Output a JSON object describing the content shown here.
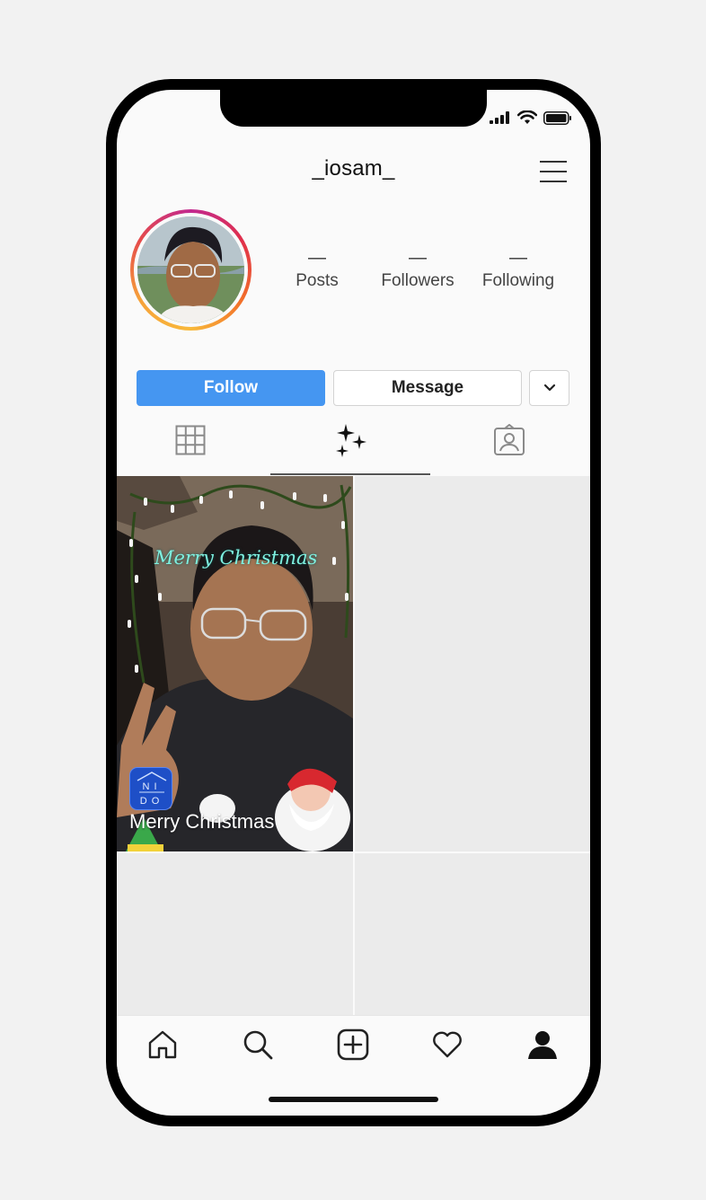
{
  "profile": {
    "username": "_iosam_",
    "stats": [
      {
        "value": "—",
        "label": "Posts"
      },
      {
        "value": "—",
        "label": "Followers"
      },
      {
        "value": "—",
        "label": "Following"
      }
    ]
  },
  "actions": {
    "follow_label": "Follow",
    "message_label": "Message"
  },
  "tabs": [
    {
      "icon": "grid-icon"
    },
    {
      "icon": "sparkles-icon",
      "active": true
    },
    {
      "icon": "tagged-icon"
    }
  ],
  "post": {
    "overlay_text": "Merry Christmas",
    "caption": "Merry Christmas",
    "badge_letters": "N I\nD O"
  },
  "nav": [
    {
      "icon": "home-icon"
    },
    {
      "icon": "search-icon"
    },
    {
      "icon": "new-post-icon"
    },
    {
      "icon": "heart-icon"
    },
    {
      "icon": "profile-icon"
    }
  ],
  "colors": {
    "follow_button": "#4596f1",
    "background": "#f2f2f2",
    "screen": "#fafafa",
    "grid_placeholder": "#ebebeb"
  }
}
